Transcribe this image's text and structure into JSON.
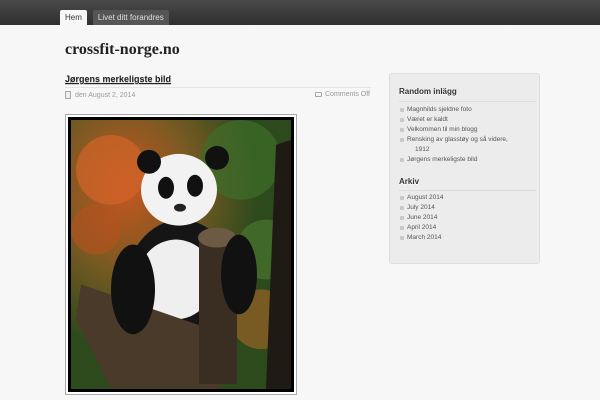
{
  "nav": {
    "items": [
      "Hem",
      "Livet ditt forandres"
    ]
  },
  "site": {
    "title": "crossfit-norge.no"
  },
  "post": {
    "title": "Jørgens merkeligste bild",
    "date": "den August 2, 2014",
    "comments": "Comments Off"
  },
  "sidebar": {
    "random_title": "Random inlägg",
    "random_items": [
      "Magnhilds sjeldne foto",
      "Været er kaldt",
      "Velkommen til min blogg",
      "Rensking av glasstøy og så videre,",
      "1912",
      "Jørgens merkeligste bild"
    ],
    "archive_title": "Arkiv",
    "archive_items": [
      "August 2014",
      "July 2014",
      "June 2014",
      "April 2014",
      "March 2014"
    ]
  }
}
